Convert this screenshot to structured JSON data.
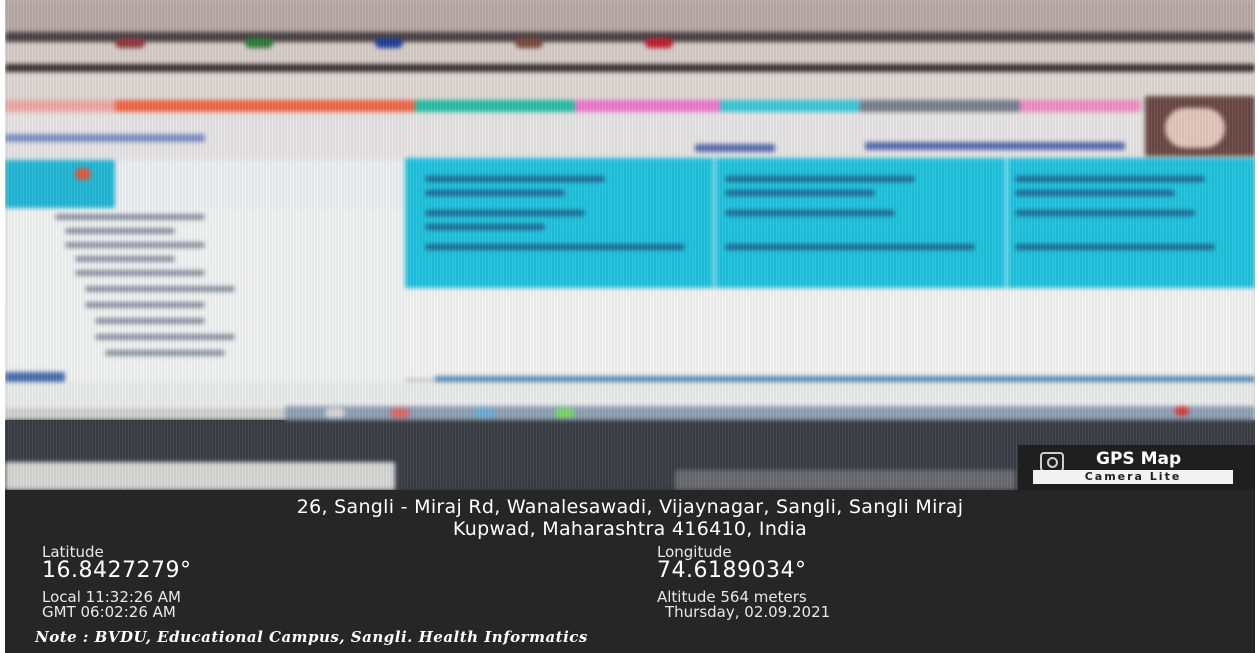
{
  "address": {
    "line1": "26, Sangli - Miraj Rd, Wanalesawadi, Vijaynagar, Sangli, Sangli Miraj",
    "line2": "Kupwad, Maharashtra 416410, India"
  },
  "latitude": {
    "label": "Latitude",
    "value": "16.8427279°"
  },
  "longitude": {
    "label": "Longitude",
    "value": "74.6189034°"
  },
  "time": {
    "local": "Local 11:32:26 AM",
    "gmt": "GMT 06:02:26 AM"
  },
  "altitude": "Altitude 564 meters",
  "date": "Thursday, 02.09.2021",
  "note": "Note : BVDU, Educational Campus, Sangli. Health Informatics",
  "badge": {
    "title": "GPS Map",
    "subtitle": "Camera Lite"
  },
  "colors": {
    "overlay": "#262626",
    "screen_cyan": "#22c5e0",
    "text": "#ffffff"
  }
}
